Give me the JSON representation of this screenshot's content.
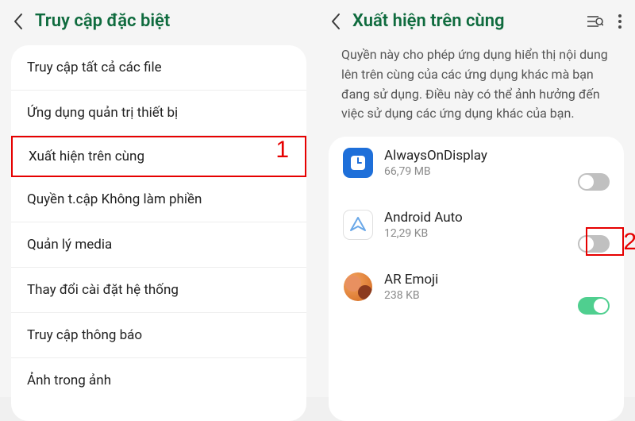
{
  "left": {
    "title": "Truy cập đặc biệt",
    "items": [
      "Truy cập tất cả các file",
      "Ứng dụng quản trị thiết bị",
      "Xuất hiện trên cùng",
      "Quyền t.cập Không làm phiền",
      "Quản lý media",
      "Thay đổi cài đặt hệ thống",
      "Truy cập thông báo",
      "Ảnh trong ảnh"
    ],
    "annotation": "1"
  },
  "right": {
    "title": "Xuất hiện trên cùng",
    "description": "Quyền này cho phép ứng dụng hiển thị nội dung lên trên cùng của các ứng dụng khác mà bạn đang sử dụng. Điều này có thể ảnh hưởng đến việc sử dụng các ứng dụng khác của bạn.",
    "apps": [
      {
        "name": "AlwaysOnDisplay",
        "size": "66,79 MB",
        "on": false
      },
      {
        "name": "Android Auto",
        "size": "12,29 KB",
        "on": false
      },
      {
        "name": "AR Emoji",
        "size": "238 KB",
        "on": true
      }
    ],
    "annotation": "2"
  }
}
